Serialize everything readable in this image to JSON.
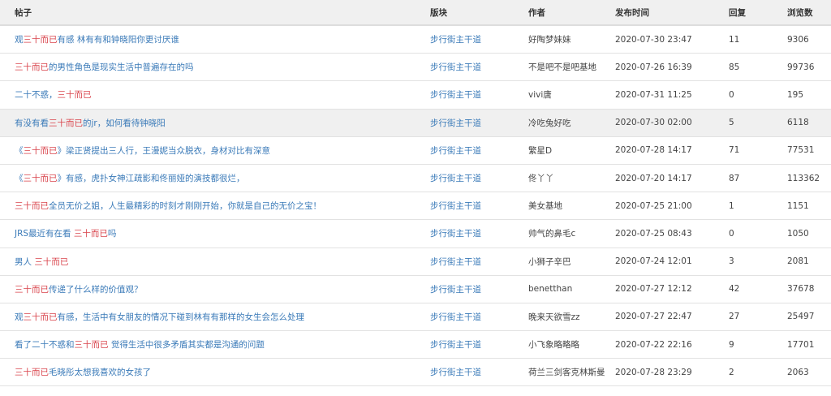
{
  "headers": [
    "帖子",
    "版块",
    "作者",
    "发布时间",
    "回复",
    "浏览数"
  ],
  "colors": {
    "link": "#3a7ab8",
    "highlight": "#d9434b",
    "header_bg": "#f0f0f0"
  },
  "rows": [
    {
      "title": [
        [
          "观",
          0
        ],
        [
          "三十而已",
          1
        ],
        [
          "有感 林有有和钟晓阳你更讨厌谁",
          0
        ]
      ],
      "board": "步行街主干道",
      "author": "好陶梦妹妹",
      "time": "2020-07-30 23:47",
      "replies": "11",
      "views": "9306"
    },
    {
      "title": [
        [
          "三十而已",
          1
        ],
        [
          "的男性角色是现实生活中普遍存在的吗",
          0
        ]
      ],
      "board": "步行街主干道",
      "author": "不是吧不是吧基地",
      "time": "2020-07-26 16:39",
      "replies": "85",
      "views": "99736"
    },
    {
      "title": [
        [
          "二十不惑，",
          0
        ],
        [
          "三十而已",
          1
        ]
      ],
      "board": "步行街主干道",
      "author": "vivi唐",
      "time": "2020-07-31 11:25",
      "replies": "0",
      "views": "195"
    },
    {
      "title": [
        [
          "有没有看",
          0
        ],
        [
          "三十而已",
          1
        ],
        [
          "的jr，如何看待钟晓阳",
          0
        ]
      ],
      "board": "步行街主干道",
      "author": "冷吃兔好吃",
      "time": "2020-07-30 02:00",
      "replies": "5",
      "views": "6118"
    },
    {
      "title": [
        [
          "《",
          0
        ],
        [
          "三十而已",
          1
        ],
        [
          "》梁正贤提出三人行，王漫妮当众脱衣，身材对比有深意",
          0
        ]
      ],
      "board": "步行街主干道",
      "author": "繁星D",
      "time": "2020-07-28 14:17",
      "replies": "71",
      "views": "77531"
    },
    {
      "title": [
        [
          "《",
          0
        ],
        [
          "三十而已",
          1
        ],
        [
          "》有感，虎扑女神江疏影和佟丽娅的演技都很烂，",
          0
        ]
      ],
      "board": "步行街主干道",
      "author": "佟丫丫",
      "time": "2020-07-20 14:17",
      "replies": "87",
      "views": "113362"
    },
    {
      "title": [
        [
          "三十而已",
          1
        ],
        [
          "全员无价之姐，人生最精彩的时刻才刚刚开始，你就是自己的无价之宝！",
          0
        ]
      ],
      "board": "步行街主干道",
      "author": "美女基地",
      "time": "2020-07-25 21:00",
      "replies": "1",
      "views": "1151"
    },
    {
      "title": [
        [
          "JRS最近有在看 ",
          0
        ],
        [
          "三十而已",
          1
        ],
        [
          "吗",
          0
        ]
      ],
      "board": "步行街主干道",
      "author": "帅气的鼻毛c",
      "time": "2020-07-25 08:43",
      "replies": "0",
      "views": "1050"
    },
    {
      "title": [
        [
          "男人 ",
          0
        ],
        [
          "三十而已",
          1
        ]
      ],
      "board": "步行街主干道",
      "author": "小狮子辛巴",
      "time": "2020-07-24 12:01",
      "replies": "3",
      "views": "2081"
    },
    {
      "title": [
        [
          "三十而已",
          1
        ],
        [
          "传递了什么样的价值观？",
          0
        ]
      ],
      "board": "步行街主干道",
      "author": "benetthan",
      "time": "2020-07-27 12:12",
      "replies": "42",
      "views": "37678"
    },
    {
      "title": [
        [
          "观",
          0
        ],
        [
          "三十而已",
          1
        ],
        [
          "有感，生活中有女朋友的情况下碰到林有有那样的女生会怎么处理",
          0
        ]
      ],
      "board": "步行街主干道",
      "author": "晚来天欲雪zz",
      "time": "2020-07-27 22:47",
      "replies": "27",
      "views": "25497"
    },
    {
      "title": [
        [
          "看了二十不惑和",
          0
        ],
        [
          "三十而已",
          1
        ],
        [
          " 觉得生活中很多矛盾其实都是沟通的问题",
          0
        ]
      ],
      "board": "步行街主干道",
      "author": "小飞象略略略",
      "time": "2020-07-22 22:16",
      "replies": "9",
      "views": "17701"
    },
    {
      "title": [
        [
          "三十而已",
          1
        ],
        [
          "毛晓彤太想我喜欢的女孩了",
          0
        ]
      ],
      "board": "步行街主干道",
      "author": "荷兰三剑客克林斯曼",
      "time": "2020-07-28 23:29",
      "replies": "2",
      "views": "2063"
    }
  ]
}
